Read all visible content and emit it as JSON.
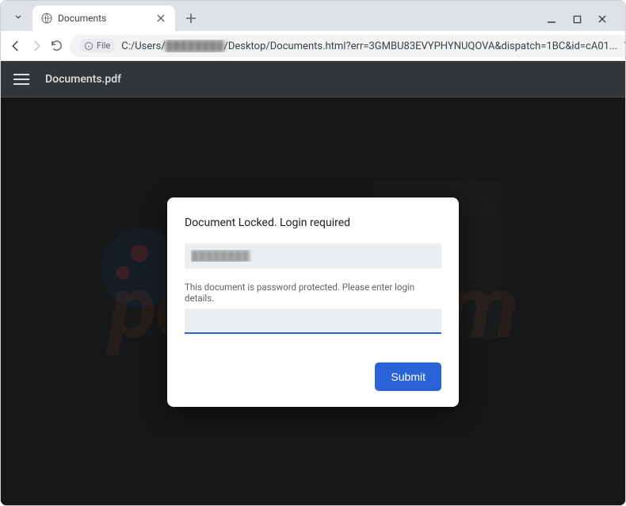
{
  "browser": {
    "tab": {
      "title": "Documents"
    },
    "omnibox": {
      "scheme_label": "File",
      "url_prefix": "C:/Users/",
      "url_blurred": "████████",
      "url_suffix": "/Desktop/Documents.html?err=3GMBU83EVYPHYNUQOVA&dispatch=1BC&id=cA01..."
    }
  },
  "pdf_header": {
    "title": "Documents.pdf"
  },
  "dialog": {
    "title": "Document Locked. Login required",
    "email_value": "████████",
    "hint": "This document is password protected. Please enter login details.",
    "password_value": "",
    "submit_label": "Submit"
  },
  "watermark": {
    "text": "pcrisk.com"
  }
}
